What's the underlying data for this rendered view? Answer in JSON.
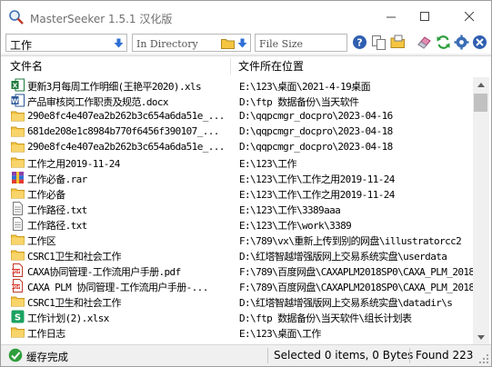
{
  "window": {
    "title": "MasterSeeker 1.5.1 汉化版",
    "app_icon": "masterseeker-app-icon"
  },
  "toolbar": {
    "search_value": "工作",
    "directory_placeholder": "In Directory",
    "size_placeholder": "File Size",
    "icons": [
      "help-icon",
      "copy-icon",
      "folder-check-icon",
      "eraser-icon",
      "refresh-icon",
      "settings-icon",
      "close-circle-icon"
    ]
  },
  "list": {
    "columns": [
      "文件名",
      "文件所在位置"
    ],
    "rows": [
      {
        "icon": "excel-icon",
        "name": "更新3月每周工作明细(王艳平2020).xls",
        "path": "E:\\123\\桌面\\2021-4-19桌面"
      },
      {
        "icon": "word-icon",
        "name": "产品审核岗工作职责及规范.docx",
        "path": "D:\\ftp 数据备份\\当天软件"
      },
      {
        "icon": "folder-icon",
        "name": "290e8fc4e407ea2b262b3c654a6da51e_...",
        "path": "D:\\qqpcmgr_docpro\\2023-04-16"
      },
      {
        "icon": "folder-icon",
        "name": "681de208e1c8984b770f6456f390107_...",
        "path": "D:\\qqpcmgr_docpro\\2023-04-18"
      },
      {
        "icon": "folder-icon",
        "name": "290e8fc4e407ea2b262b3c654a6da51e_...",
        "path": "D:\\qqpcmgr_docpro\\2023-04-18"
      },
      {
        "icon": "folder-icon",
        "name": "工作之用2019-11-24",
        "path": "E:\\123\\工作"
      },
      {
        "icon": "rar-icon",
        "name": "工作必备.rar",
        "path": "E:\\123\\工作\\工作之用2019-11-24"
      },
      {
        "icon": "folder-icon",
        "name": "工作必备",
        "path": "E:\\123\\工作\\工作之用2019-11-24"
      },
      {
        "icon": "text-file-icon",
        "name": "工作路径.txt",
        "path": "E:\\123\\工作\\3389aaa"
      },
      {
        "icon": "text-file-icon",
        "name": "工作路径.txt",
        "path": "E:\\123\\工作\\work\\3389"
      },
      {
        "icon": "folder-icon",
        "name": "工作区",
        "path": "F:\\789\\vx\\重新上传到别的网盘\\illustratorcc2"
      },
      {
        "icon": "folder-icon",
        "name": "CSRC1卫生和社会工作",
        "path": "D:\\红塔智越增强版网上交易系统实盘\\userdata"
      },
      {
        "icon": "pdf-icon",
        "name": "CAXA协同管理-工作流用户手册.pdf",
        "path": "F:\\789\\百度网盘\\CAXAPLM2018SP0\\CAXA_PLM_2018"
      },
      {
        "icon": "pdf-icon",
        "name": "CAXA PLM 协同管理-工作流用户手册-...",
        "path": "F:\\789\\百度网盘\\CAXAPLM2018SP0\\CAXA_PLM_2018"
      },
      {
        "icon": "folder-icon",
        "name": "CSRC1卫生和社会工作",
        "path": "D:\\红塔智越增强版网上交易系统实盘\\datadir\\s"
      },
      {
        "icon": "spreadsheet-icon",
        "name": "工作计划(2).xlsx",
        "path": "D:\\ftp 数据备份\\当天软件\\组长计划表"
      },
      {
        "icon": "folder-icon",
        "name": "工作日志",
        "path": "E:\\123\\桌面\\工作"
      }
    ]
  },
  "status": {
    "icon": "check-circle-icon",
    "text": "缓存完成",
    "selected": "Selected 0 items, 0 Bytes",
    "found": "Found 223"
  },
  "colors": {
    "accent_blue": "#2f6fd6",
    "folder_yellow": "#f5c542",
    "status_green": "#2e9e3c"
  }
}
